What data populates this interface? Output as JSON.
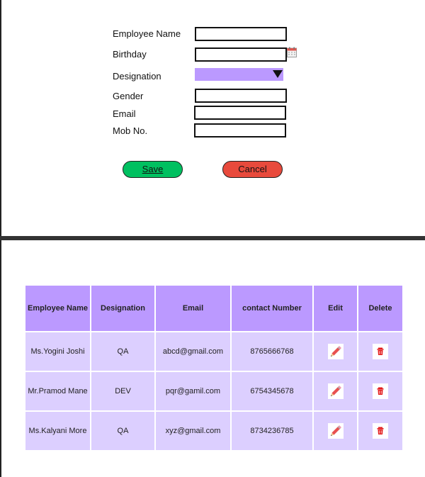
{
  "form": {
    "fields": [
      {
        "label": "Employee Name",
        "value": ""
      },
      {
        "label": "Birthday",
        "value": ""
      },
      {
        "label": "Designation",
        "value": ""
      },
      {
        "label": "Gender",
        "value": ""
      },
      {
        "label": "Email",
        "value": ""
      },
      {
        "label": "Mob No.",
        "value": ""
      }
    ],
    "calendar_icon": "calendar-icon",
    "select_icon": "dropdown-arrow-icon",
    "save_label": "Save",
    "cancel_label": "Cancel"
  },
  "table": {
    "headers": [
      "Employee Name",
      "Designation",
      "Email",
      "contact Number",
      "Edit",
      "Delete"
    ],
    "rows": [
      {
        "name": "Ms.Yogini Joshi",
        "designation": "QA",
        "email": "abcd@gmail.com",
        "contact": "8765666768"
      },
      {
        "name": "Mr.Pramod Mane",
        "designation": "DEV",
        "email": "pqr@gamil.com",
        "contact": "6754345678"
      },
      {
        "name": "Ms.Kalyani More",
        "designation": "QA",
        "email": "xyz@gmail.com",
        "contact": "8734236785"
      }
    ],
    "edit_icon": "pencil-icon",
    "delete_icon": "trash-icon"
  },
  "colors": {
    "header_bg": "#bb99ff",
    "row_bg": "#dccfff",
    "save_bg": "#00c060",
    "cancel_bg": "#e84a3c"
  }
}
